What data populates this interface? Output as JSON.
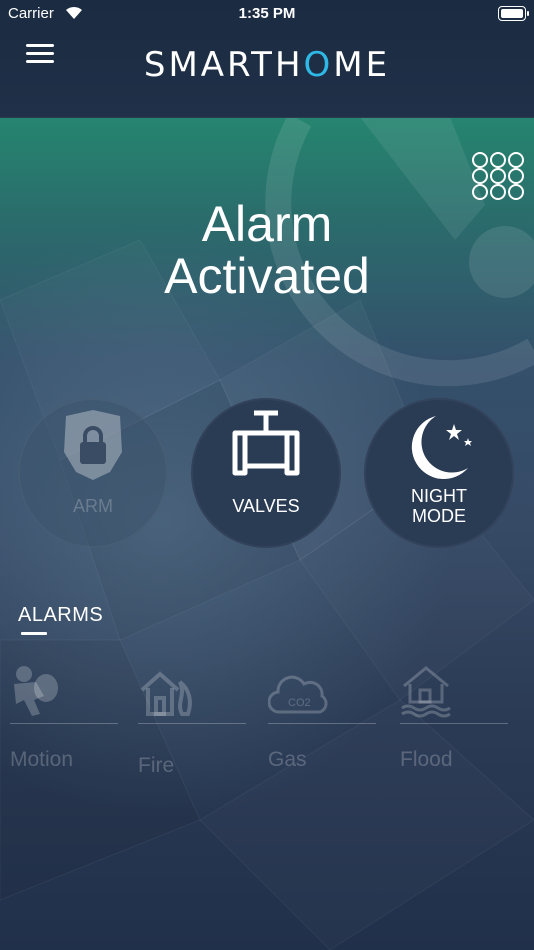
{
  "status_bar": {
    "carrier": "Carrier",
    "time": "1:35 PM"
  },
  "header": {
    "logo_left": "SMARTH",
    "logo_right": "ME",
    "logo_dot_color": "#2fb7e6"
  },
  "hero": {
    "line1": "Alarm",
    "line2": "Activated"
  },
  "modes": [
    {
      "label": "ARM",
      "icon": "shield-lock-icon",
      "active": false
    },
    {
      "label": "VALVES",
      "icon": "valve-icon",
      "active": true
    },
    {
      "label_line1": "NIGHT",
      "label_line2": "MODE",
      "icon": "moon-stars-icon",
      "active": true
    }
  ],
  "alarms": {
    "title": "ALARMS",
    "items": [
      {
        "label": "Motion",
        "icon": "burglar-icon"
      },
      {
        "label": "Fire",
        "icon": "house-fire-icon"
      },
      {
        "label": "Gas",
        "icon": "co2-cloud-icon"
      },
      {
        "label": "Flood",
        "icon": "house-flood-icon"
      }
    ]
  },
  "colors": {
    "accent_teal": "#1fa388",
    "header_bg": "#1b2b41",
    "mode_bg": "#2a3b54"
  }
}
